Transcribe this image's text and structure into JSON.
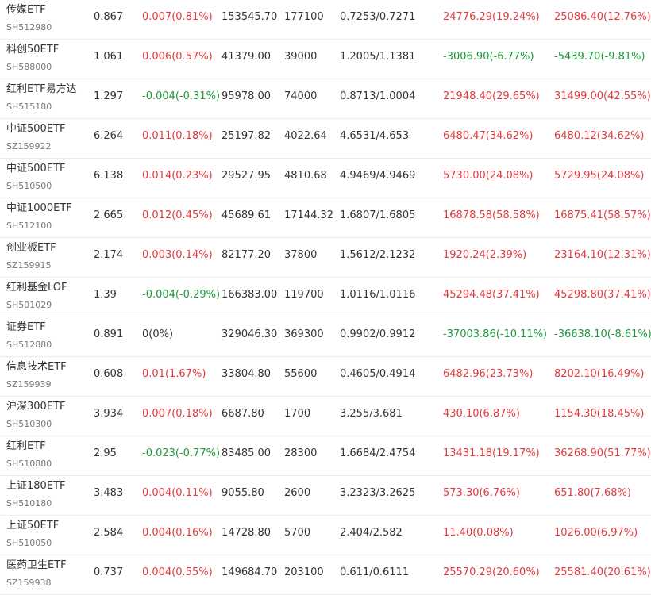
{
  "colors": {
    "up": "#e4393c",
    "down": "#1a9a3a",
    "flat": "#333333"
  },
  "rows": [
    {
      "name": "传媒ETF",
      "code": "SH512980",
      "price": "0.867",
      "change": "0.007(0.81%)",
      "change_dir": "up",
      "market_value": "153545.70",
      "quantity": "177100",
      "cost": "0.7253/0.7271",
      "profit": "24776.29(19.24%)",
      "profit_dir": "up",
      "acc_profit": "25086.40(12.76%)",
      "acc_profit_dir": "up"
    },
    {
      "name": "科创50ETF",
      "code": "SH588000",
      "price": "1.061",
      "change": "0.006(0.57%)",
      "change_dir": "up",
      "market_value": "41379.00",
      "quantity": "39000",
      "cost": "1.2005/1.1381",
      "profit": "-3006.90(-6.77%)",
      "profit_dir": "down",
      "acc_profit": "-5439.70(-9.81%)",
      "acc_profit_dir": "down"
    },
    {
      "name": "红利ETF易方达",
      "code": "SH515180",
      "price": "1.297",
      "change": "-0.004(-0.31%)",
      "change_dir": "down",
      "market_value": "95978.00",
      "quantity": "74000",
      "cost": "0.8713/1.0004",
      "profit": "21948.40(29.65%)",
      "profit_dir": "up",
      "acc_profit": "31499.00(42.55%)",
      "acc_profit_dir": "up"
    },
    {
      "name": "中证500ETF",
      "code": "SZ159922",
      "price": "6.264",
      "change": "0.011(0.18%)",
      "change_dir": "up",
      "market_value": "25197.82",
      "quantity": "4022.64",
      "cost": "4.6531/4.653",
      "profit": "6480.47(34.62%)",
      "profit_dir": "up",
      "acc_profit": "6480.12(34.62%)",
      "acc_profit_dir": "up"
    },
    {
      "name": "中证500ETF",
      "code": "SH510500",
      "price": "6.138",
      "change": "0.014(0.23%)",
      "change_dir": "up",
      "market_value": "29527.95",
      "quantity": "4810.68",
      "cost": "4.9469/4.9469",
      "profit": "5730.00(24.08%)",
      "profit_dir": "up",
      "acc_profit": "5729.95(24.08%)",
      "acc_profit_dir": "up"
    },
    {
      "name": "中证1000ETF",
      "code": "SH512100",
      "price": "2.665",
      "change": "0.012(0.45%)",
      "change_dir": "up",
      "market_value": "45689.61",
      "quantity": "17144.32",
      "cost": "1.6807/1.6805",
      "profit": "16878.58(58.58%)",
      "profit_dir": "up",
      "acc_profit": "16875.41(58.57%)",
      "acc_profit_dir": "up"
    },
    {
      "name": "创业板ETF",
      "code": "SZ159915",
      "price": "2.174",
      "change": "0.003(0.14%)",
      "change_dir": "up",
      "market_value": "82177.20",
      "quantity": "37800",
      "cost": "1.5612/2.1232",
      "profit": "1920.24(2.39%)",
      "profit_dir": "up",
      "acc_profit": "23164.10(12.31%)",
      "acc_profit_dir": "up"
    },
    {
      "name": "红利基金LOF",
      "code": "SH501029",
      "price": "1.39",
      "change": "-0.004(-0.29%)",
      "change_dir": "down",
      "market_value": "166383.00",
      "quantity": "119700",
      "cost": "1.0116/1.0116",
      "profit": "45294.48(37.41%)",
      "profit_dir": "up",
      "acc_profit": "45298.80(37.41%)",
      "acc_profit_dir": "up"
    },
    {
      "name": "证券ETF",
      "code": "SH512880",
      "price": "0.891",
      "change": "0(0%)",
      "change_dir": "flat",
      "market_value": "329046.30",
      "quantity": "369300",
      "cost": "0.9902/0.9912",
      "profit": "-37003.86(-10.11%)",
      "profit_dir": "down",
      "acc_profit": "-36638.10(-8.61%)",
      "acc_profit_dir": "down"
    },
    {
      "name": "信息技术ETF",
      "code": "SZ159939",
      "price": "0.608",
      "change": "0.01(1.67%)",
      "change_dir": "up",
      "market_value": "33804.80",
      "quantity": "55600",
      "cost": "0.4605/0.4914",
      "profit": "6482.96(23.73%)",
      "profit_dir": "up",
      "acc_profit": "8202.10(16.49%)",
      "acc_profit_dir": "up"
    },
    {
      "name": "沪深300ETF",
      "code": "SH510300",
      "price": "3.934",
      "change": "0.007(0.18%)",
      "change_dir": "up",
      "market_value": "6687.80",
      "quantity": "1700",
      "cost": "3.255/3.681",
      "profit": "430.10(6.87%)",
      "profit_dir": "up",
      "acc_profit": "1154.30(18.45%)",
      "acc_profit_dir": "up"
    },
    {
      "name": "红利ETF",
      "code": "SH510880",
      "price": "2.95",
      "change": "-0.023(-0.77%)",
      "change_dir": "down",
      "market_value": "83485.00",
      "quantity": "28300",
      "cost": "1.6684/2.4754",
      "profit": "13431.18(19.17%)",
      "profit_dir": "up",
      "acc_profit": "36268.90(51.77%)",
      "acc_profit_dir": "up"
    },
    {
      "name": "上证180ETF",
      "code": "SH510180",
      "price": "3.483",
      "change": "0.004(0.11%)",
      "change_dir": "up",
      "market_value": "9055.80",
      "quantity": "2600",
      "cost": "3.2323/3.2625",
      "profit": "573.30(6.76%)",
      "profit_dir": "up",
      "acc_profit": "651.80(7.68%)",
      "acc_profit_dir": "up"
    },
    {
      "name": "上证50ETF",
      "code": "SH510050",
      "price": "2.584",
      "change": "0.004(0.16%)",
      "change_dir": "up",
      "market_value": "14728.80",
      "quantity": "5700",
      "cost": "2.404/2.582",
      "profit": "11.40(0.08%)",
      "profit_dir": "up",
      "acc_profit": "1026.00(6.97%)",
      "acc_profit_dir": "up"
    },
    {
      "name": "医药卫生ETF",
      "code": "SZ159938",
      "price": "0.737",
      "change": "0.004(0.55%)",
      "change_dir": "up",
      "market_value": "149684.70",
      "quantity": "203100",
      "cost": "0.611/0.6111",
      "profit": "25570.29(20.60%)",
      "profit_dir": "up",
      "acc_profit": "25581.40(20.61%)",
      "acc_profit_dir": "up"
    }
  ]
}
